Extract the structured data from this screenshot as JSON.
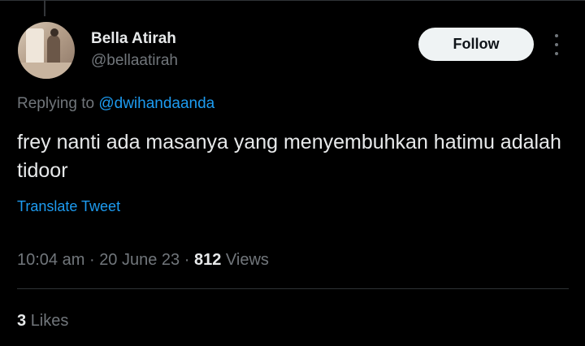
{
  "user": {
    "display_name": "Bella Atirah",
    "handle": "@bellaatirah"
  },
  "actions": {
    "follow_label": "Follow",
    "more_icon": "more-vertical-icon"
  },
  "reply": {
    "prefix": "Replying to",
    "mention": "@dwihandaanda"
  },
  "tweet": {
    "text": "frey nanti ada masanya yang menyembuhkan hatimu adalah tidoor",
    "translate_label": "Translate Tweet"
  },
  "meta": {
    "time": "10:04 am",
    "date": "20 June 23",
    "separator": "·",
    "views_count": "812",
    "views_label": "Views"
  },
  "stats": {
    "likes_count": "3",
    "likes_label": "Likes"
  },
  "colors": {
    "background": "#000000",
    "text_primary": "#e7e9ea",
    "text_secondary": "#71767b",
    "link": "#1d9bf0",
    "follow_bg": "#eff3f4",
    "divider": "#2f3336"
  }
}
